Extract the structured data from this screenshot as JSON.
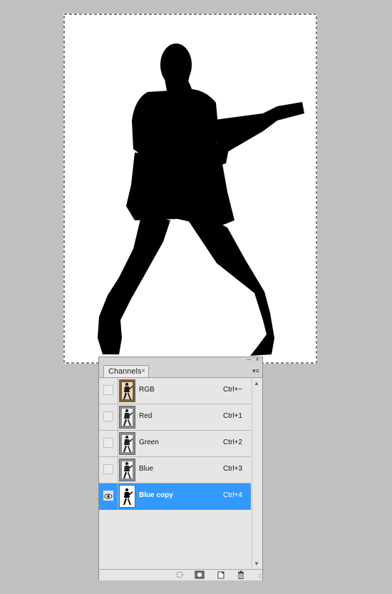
{
  "panel": {
    "tab_label": "Channels",
    "tab_close": "×",
    "window_minimize": "‒",
    "window_close": "×",
    "menu_icon": "▾≡"
  },
  "channels": [
    {
      "name": "RGB",
      "shortcut": "Ctrl+~",
      "visible": false,
      "selected": false,
      "thumb": "color"
    },
    {
      "name": "Red",
      "shortcut": "Ctrl+1",
      "visible": false,
      "selected": false,
      "thumb": "gray"
    },
    {
      "name": "Green",
      "shortcut": "Ctrl+2",
      "visible": false,
      "selected": false,
      "thumb": "gray"
    },
    {
      "name": "Blue",
      "shortcut": "Ctrl+3",
      "visible": false,
      "selected": false,
      "thumb": "gray"
    },
    {
      "name": "Blue copy",
      "shortcut": "Ctrl+4",
      "visible": true,
      "selected": true,
      "thumb": "mask"
    }
  ],
  "footer_icons": [
    "load-selection-icon",
    "save-selection-icon",
    "new-channel-icon",
    "trash-icon"
  ],
  "colors": {
    "selection": "#3399ff",
    "panel": "#e6e6e6",
    "workspace": "#c0c0c0"
  }
}
